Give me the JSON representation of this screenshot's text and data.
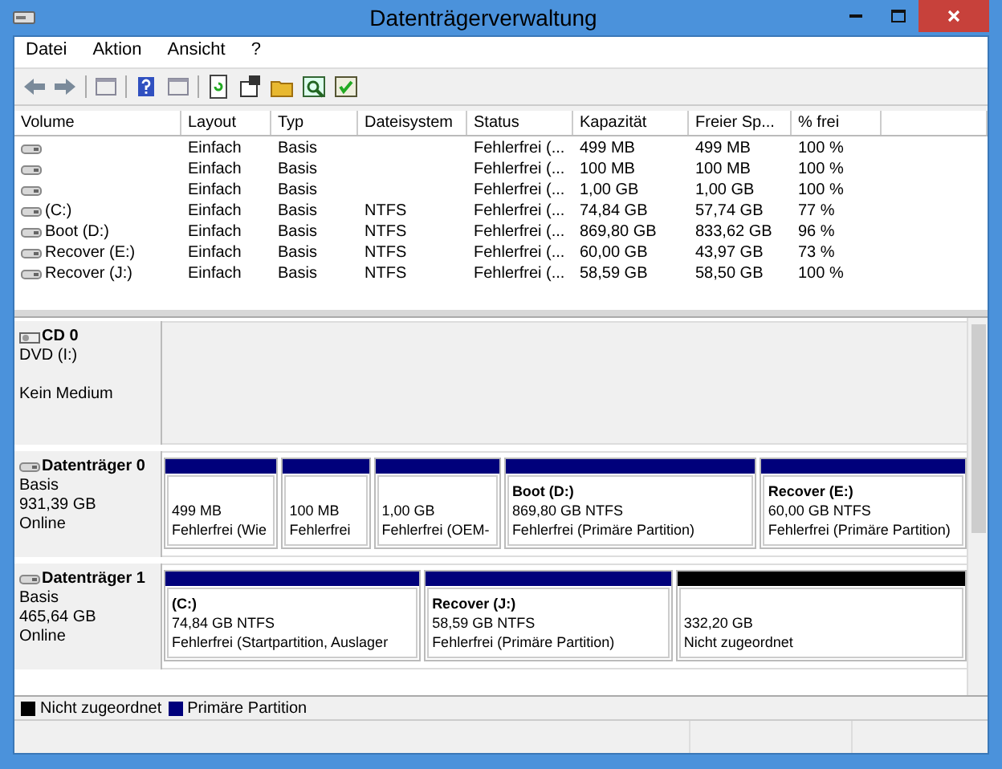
{
  "window": {
    "title": "Datenträgerverwaltung"
  },
  "menu": [
    {
      "label": "Datei"
    },
    {
      "label": "Aktion"
    },
    {
      "label": "Ansicht"
    },
    {
      "label": "?"
    }
  ],
  "table": {
    "columns": [
      "Volume",
      "Layout",
      "Typ",
      "Dateisystem",
      "Status",
      "Kapazität",
      "Freier Sp...",
      "% frei"
    ],
    "rows": [
      {
        "layout": "Einfach",
        "type": "Basis",
        "status": "Fehlerfrei (...",
        "capacity": "499 MB",
        "free": "499 MB",
        "percent_free": "100 %"
      },
      {
        "layout": "Einfach",
        "type": "Basis",
        "status": "Fehlerfrei (...",
        "capacity": "100 MB",
        "free": "100 MB",
        "percent_free": "100 %"
      },
      {
        "layout": "Einfach",
        "type": "Basis",
        "status": "Fehlerfrei (...",
        "capacity": "1,00 GB",
        "free": "1,00 GB",
        "percent_free": "100 %"
      },
      {
        "volume": "(C:)",
        "layout": "Einfach",
        "type": "Basis",
        "filesystem": "NTFS",
        "status": "Fehlerfrei (...",
        "capacity": "74,84 GB",
        "free": "57,74 GB",
        "percent_free": "77 %"
      },
      {
        "volume": "Boot (D:)",
        "layout": "Einfach",
        "type": "Basis",
        "filesystem": "NTFS",
        "status": "Fehlerfrei (...",
        "capacity": "869,80 GB",
        "free": "833,62 GB",
        "percent_free": "96 %"
      },
      {
        "volume": "Recover (E:)",
        "layout": "Einfach",
        "type": "Basis",
        "filesystem": "NTFS",
        "status": "Fehlerfrei (...",
        "capacity": "60,00 GB",
        "free": "43,97 GB",
        "percent_free": "73 %"
      },
      {
        "volume": "Recover (J:)",
        "layout": "Einfach",
        "type": "Basis",
        "filesystem": "NTFS",
        "status": "Fehlerfrei (...",
        "capacity": "58,59 GB",
        "free": "58,50 GB",
        "percent_free": "100 %"
      }
    ]
  },
  "disks": [
    {
      "kind": "cdrom",
      "name": "CD 0",
      "type": "DVD (I:)",
      "status": "Kein Medium"
    },
    {
      "kind": "disk",
      "name": "Datenträger 0",
      "type": "Basis",
      "capacity": "931,39 GB",
      "status": "Online",
      "partitions": [
        {
          "kind": "primary",
          "size": "499 MB",
          "status": "Fehlerfrei (Wie"
        },
        {
          "kind": "primary",
          "size": "100 MB",
          "status": "Fehlerfrei"
        },
        {
          "kind": "primary",
          "size": "1,00 GB",
          "status": "Fehlerfrei (OEM-"
        },
        {
          "kind": "primary",
          "label": "Boot  (D:)",
          "size": "869,80 GB NTFS",
          "status": "Fehlerfrei (Primäre Partition)"
        },
        {
          "kind": "primary",
          "label": "Recover  (E:)",
          "size": "60,00 GB NTFS",
          "status": "Fehlerfrei (Primäre Partition)"
        }
      ]
    },
    {
      "kind": "disk",
      "name": "Datenträger 1",
      "type": "Basis",
      "capacity": "465,64 GB",
      "status": "Online",
      "partitions": [
        {
          "kind": "primary",
          "label": "(C:)",
          "size": "74,84 GB NTFS",
          "status": "Fehlerfrei (Startpartition, Auslager"
        },
        {
          "kind": "primary",
          "label": "Recover  (J:)",
          "size": "58,59 GB NTFS",
          "status": "Fehlerfrei (Primäre Partition)"
        },
        {
          "kind": "unallocated",
          "size": "332,20 GB",
          "status": "Nicht zugeordnet"
        }
      ]
    }
  ],
  "legend": [
    {
      "kind": "unallocated",
      "label": "Nicht zugeordnet"
    },
    {
      "kind": "primary",
      "label": "Primäre Partition"
    }
  ]
}
